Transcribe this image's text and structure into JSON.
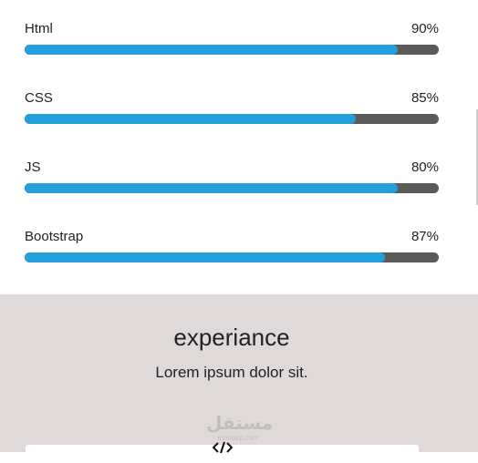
{
  "skills": {
    "items": [
      {
        "name": "Html",
        "percent_label": "90%",
        "level": 0.9
      },
      {
        "name": "CSS",
        "percent_label": "85%",
        "level": 0.8
      },
      {
        "name": "JS",
        "percent_label": "80%",
        "level": 0.9
      },
      {
        "name": "Bootstrap",
        "percent_label": "87%",
        "level": 0.87
      }
    ],
    "colors": {
      "fill": "#23a0dc",
      "track": "#5a5a5a"
    }
  },
  "experience": {
    "title": "experiance",
    "subtitle": "Lorem ipsum dolor sit.",
    "background": "#dfd9d9",
    "card_icon": "code-icon",
    "watermark": {
      "main": "مستقل",
      "sub": "mostaql.com"
    }
  }
}
